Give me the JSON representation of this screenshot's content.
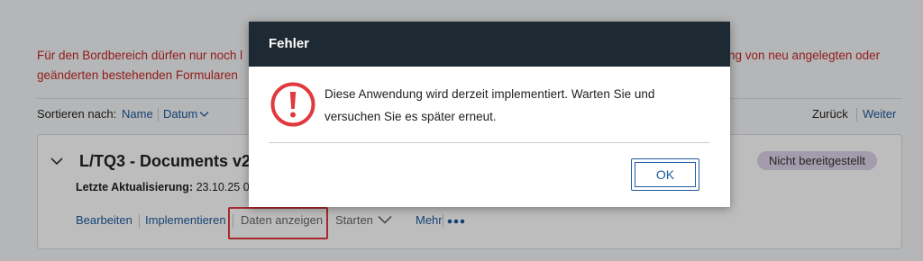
{
  "background": {
    "warning": {
      "line1_left": "Für den Bordbereich dürfen nur noch l",
      "line1_right": "ng von neu angelegten oder",
      "line2": "geänderten bestehenden Formularen"
    },
    "sort": {
      "label": "Sortieren nach:",
      "name": "Name",
      "date": "Datum",
      "back": "Zurück",
      "next": "Weiter"
    },
    "card": {
      "title": "L/TQ3 - Documents v2",
      "updated_label": "Letzte Aktualisierung:",
      "updated_value": "23.10.25 0",
      "badge": "Nicht bereitgestellt",
      "actions": {
        "edit": "Bearbeiten",
        "deploy": "Implementieren",
        "view_data": "Daten anzeigen",
        "start": "Starten",
        "more": "Mehr"
      }
    }
  },
  "dialog": {
    "title": "Fehler",
    "message_line1": "Diese Anwendung wird derzeit implementiert. Warten Sie und",
    "message_line2": "versuchen Sie es später erneut.",
    "ok_label": "OK"
  },
  "colors": {
    "accent": "#1c5a9e",
    "error": "#e0393e",
    "warning_text": "#c62828",
    "dialog_header": "#1e2a33",
    "badge": "#dcd3e8"
  },
  "icons": {
    "error": "exclamation-circle-icon",
    "expand": "chevron-down-icon",
    "more": "ellipsis-icon"
  }
}
